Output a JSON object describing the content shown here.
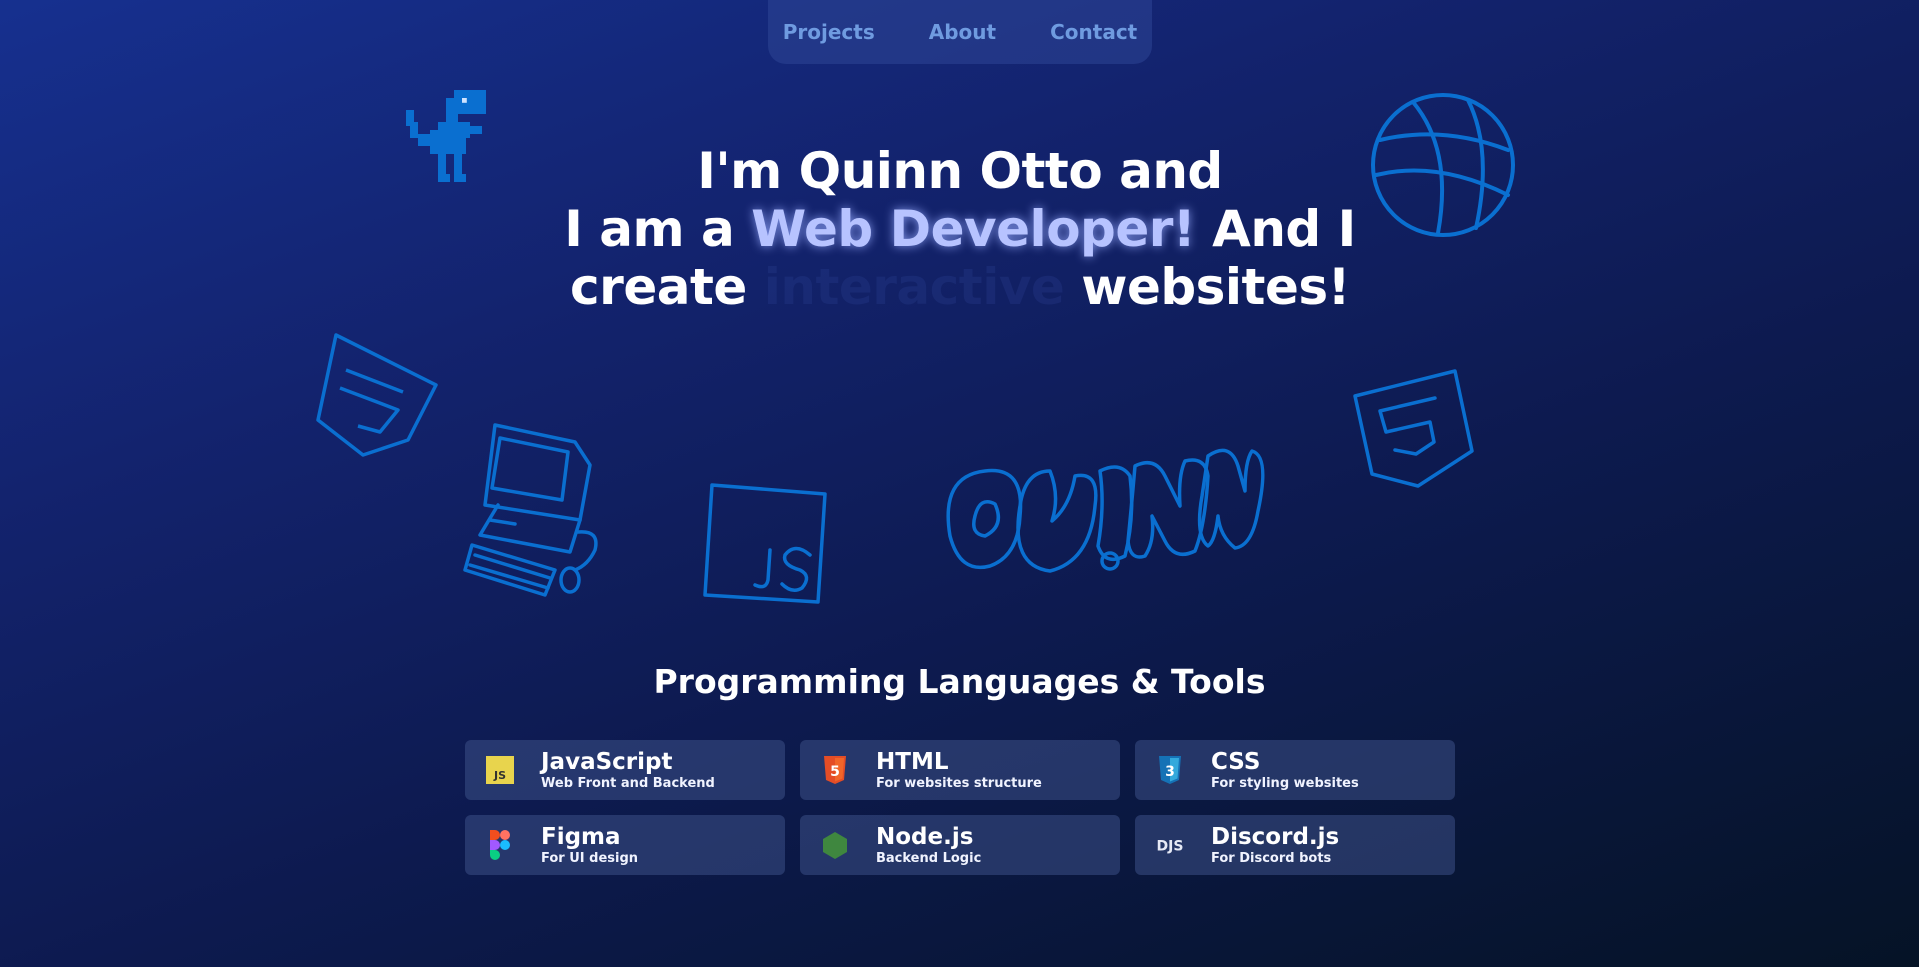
{
  "nav": {
    "items": [
      "Projects",
      "About",
      "Contact"
    ]
  },
  "hero": {
    "line1": "I'm Quinn Otto and",
    "line2_prefix": "I am a ",
    "line2_highlight": "Web Developer!",
    "line2_suffix": " And I",
    "line3_prefix": "create ",
    "line3_ghost": "interactive",
    "line3_suffix": " websites!"
  },
  "doodles": [
    "dino-icon",
    "basketball-icon",
    "css-shield-icon",
    "computer-icon",
    "js-box-icon",
    "quinn-graffiti",
    "html-shield-icon"
  ],
  "doodle_color": "#0a6fd0",
  "tools": {
    "title": "Programming Languages & Tools",
    "items": [
      {
        "name": "JavaScript",
        "desc": "Web Front and Backend",
        "icon": "javascript-icon"
      },
      {
        "name": "HTML",
        "desc": "For websites structure",
        "icon": "html5-icon"
      },
      {
        "name": "CSS",
        "desc": "For styling websites",
        "icon": "css3-icon"
      },
      {
        "name": "Figma",
        "desc": "For UI design",
        "icon": "figma-icon"
      },
      {
        "name": "Node.js",
        "desc": "Backend Logic",
        "icon": "nodejs-icon"
      },
      {
        "name": "Discord.js",
        "desc": "For Discord bots",
        "icon": "discordjs-icon"
      }
    ]
  }
}
